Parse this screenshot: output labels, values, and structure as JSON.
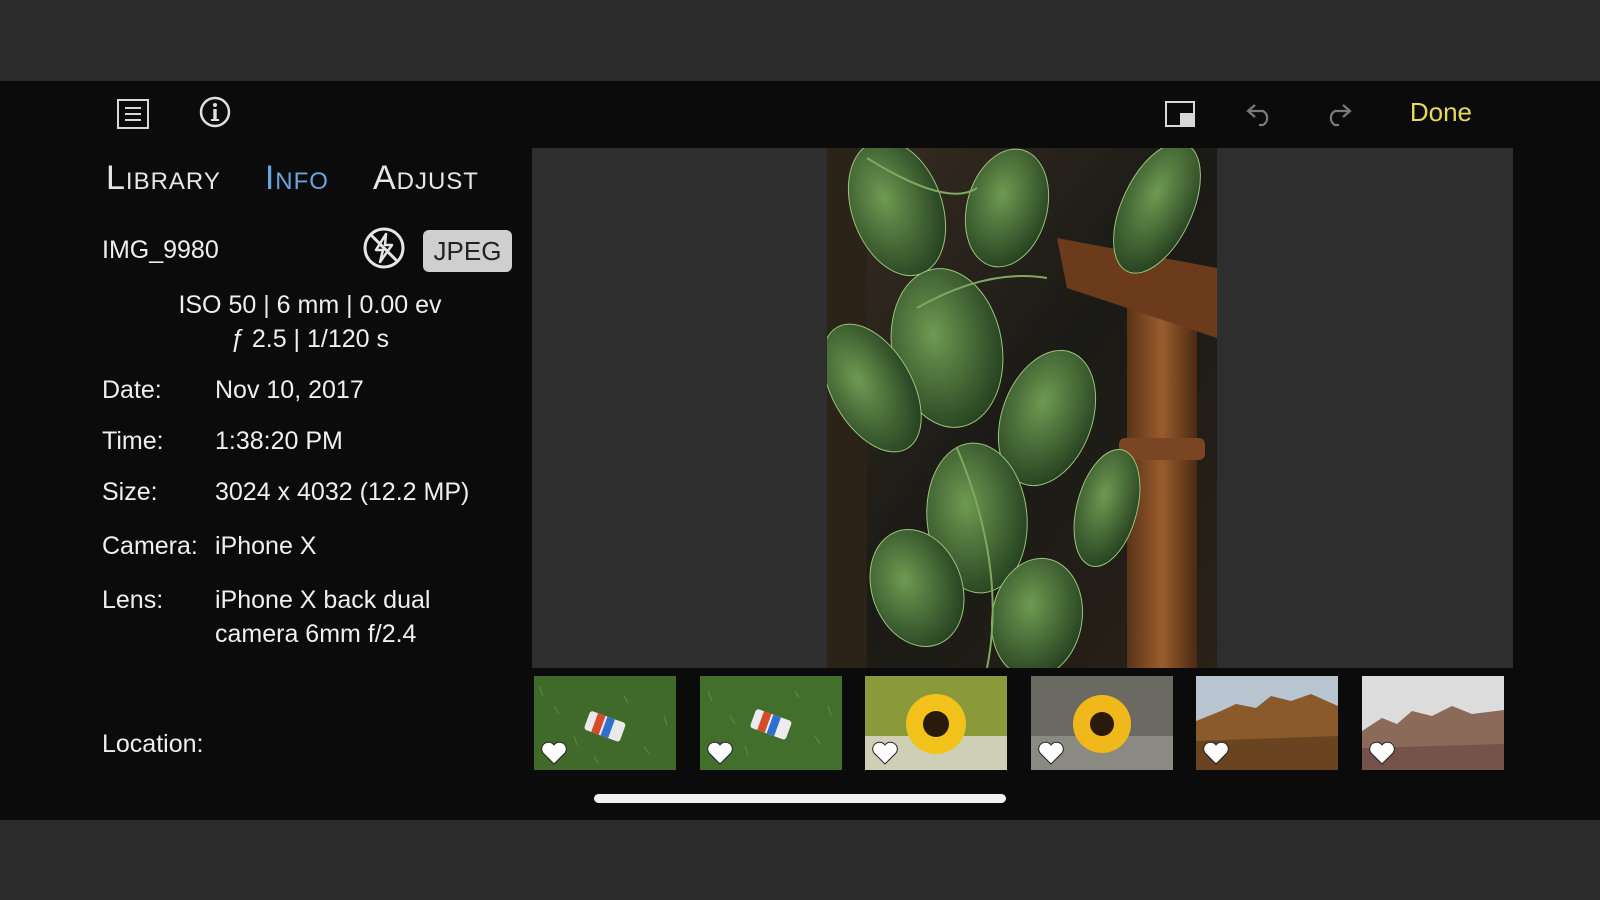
{
  "toolbar": {
    "menu_icon": "list-icon",
    "info_icon": "info-icon",
    "compare_icon": "split-view-icon",
    "undo_icon": "undo-icon",
    "redo_icon": "redo-icon",
    "done_label": "Done"
  },
  "tabs": [
    {
      "label": "Library",
      "active": false
    },
    {
      "label": "Info",
      "active": true
    },
    {
      "label": "Adjust",
      "active": false
    }
  ],
  "info": {
    "file_name": "IMG_9980",
    "flash_icon": "flash-off-icon",
    "format": "JPEG",
    "exif_line1": "ISO 50 | 6 mm | 0.00 ev",
    "exif_line2": "ƒ 2.5 | 1/120 s",
    "date_label": "Date:",
    "date_value": "Nov 10, 2017",
    "time_label": "Time:",
    "time_value": "1:38:20 PM",
    "size_label": "Size:",
    "size_value": "3024 x 4032 (12.2 MP)",
    "camera_label": "Camera:",
    "camera_value": "iPhone X",
    "lens_label": "Lens:",
    "lens_value_line1": "iPhone X back dual",
    "lens_value_line2": "camera 6mm f/2.4",
    "location_label": "Location:",
    "location_value": ""
  },
  "filmstrip": [
    {
      "subject": "can-on-grass",
      "favorite_icon": "heart-icon"
    },
    {
      "subject": "can-on-grass",
      "favorite_icon": "heart-icon"
    },
    {
      "subject": "sunflower",
      "favorite_icon": "heart-icon"
    },
    {
      "subject": "sunflower",
      "favorite_icon": "heart-icon"
    },
    {
      "subject": "badlands",
      "favorite_icon": "heart-icon"
    },
    {
      "subject": "badlands",
      "favorite_icon": "heart-icon"
    }
  ],
  "colors": {
    "accent_done": "#e7da55",
    "tab_active": "#6aa4dc",
    "background": "#0b0b0b"
  }
}
